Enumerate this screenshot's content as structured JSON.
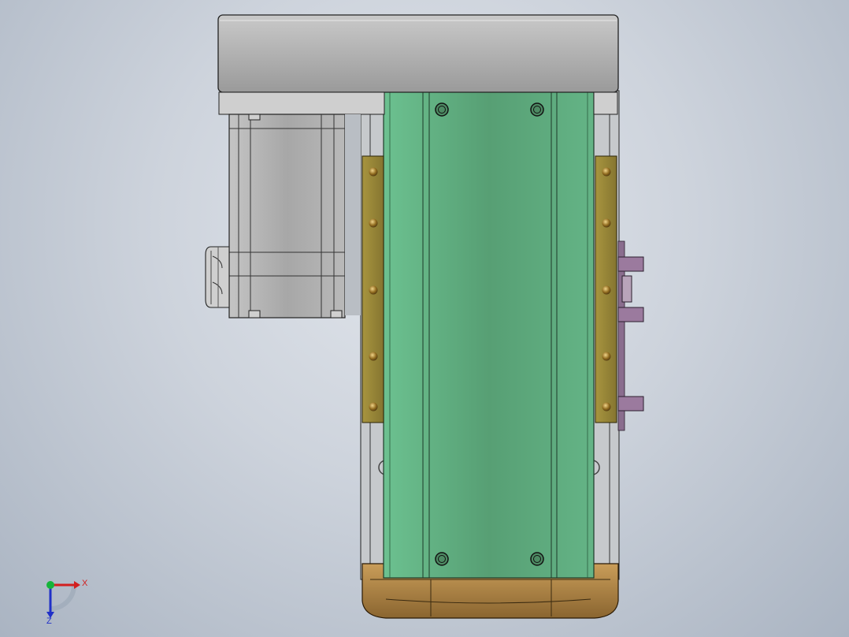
{
  "view": {
    "background_top": "#e2e6ec",
    "background_bottom": "#aab4c2",
    "model": "linear-actuator-top-view"
  },
  "colors": {
    "housing_gray": "#b0b0b0",
    "motor_gray": "#a9a9a9",
    "carriage_green": "#5fae7f",
    "rail_brass": "#9c8a3a",
    "endcap_bronze": "#b5894a",
    "connector_purple": "#9b7a9e"
  },
  "triad": {
    "x_label": "X",
    "z_label": "Z",
    "x_color": "#d21f1f",
    "y_color": "#16b43a",
    "z_color": "#2030c8"
  }
}
